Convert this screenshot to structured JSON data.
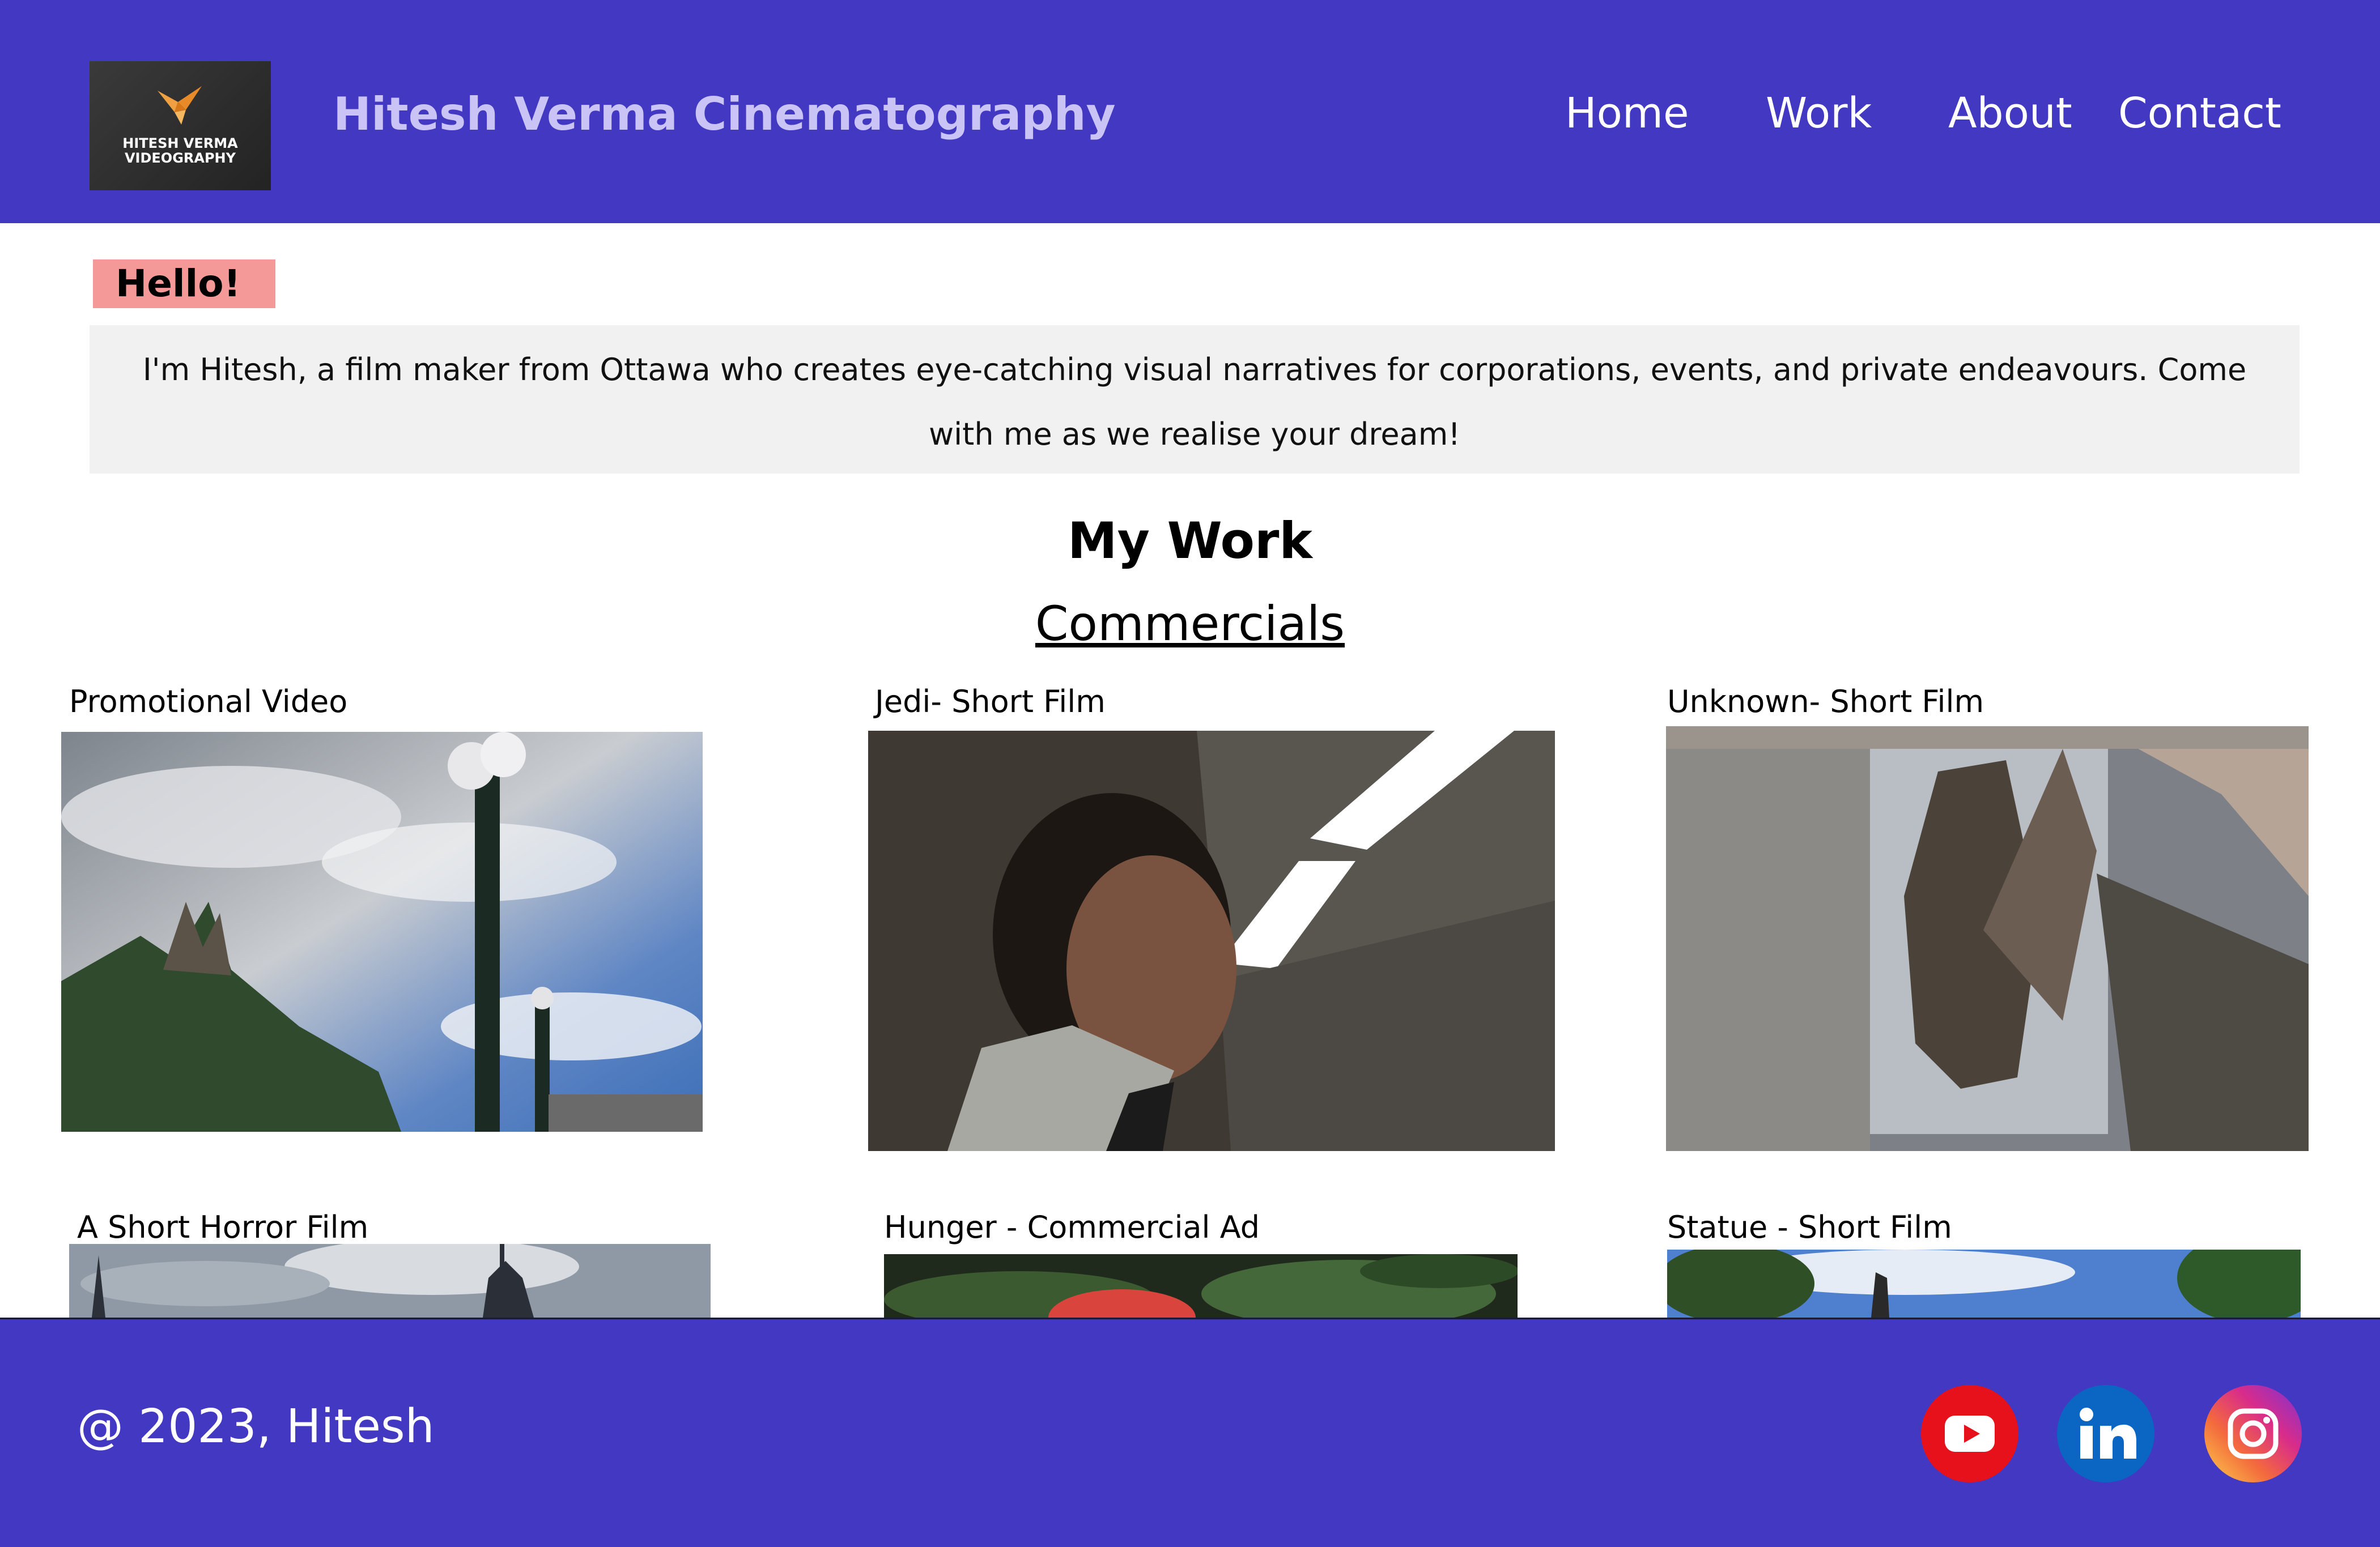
{
  "header": {
    "logo_text": "HITESH VERMA\nVIDEOGRAPHY",
    "logo_icon": "origami-bird-icon",
    "site_title": "Hitesh Verma Cinematography",
    "nav": [
      "Home",
      "Work",
      "About",
      "Contact"
    ],
    "background_color": "#4238c1"
  },
  "intro": {
    "greeting": "Hello!",
    "text": "I'm Hitesh, a film maker from Ottawa who creates eye-catching visual narratives for corporations, events, and private endeavours. Come with me as we realise your dream!",
    "greeting_color": "#f59898"
  },
  "work": {
    "heading": "My Work",
    "subheading": "Commercials",
    "cards": [
      {
        "title": "Promotional Video"
      },
      {
        "title": "Jedi- Short Film"
      },
      {
        "title": "Unknown- Short Film"
      },
      {
        "title": "A Short Horror Film"
      },
      {
        "title": "Hunger - Commercial Ad"
      },
      {
        "title": "Statue - Short Film"
      }
    ]
  },
  "footer": {
    "copyright": "@ 2023, Hitesh",
    "social": [
      "youtube-icon",
      "linkedin-icon",
      "instagram-icon"
    ],
    "background_color": "#4238c1"
  }
}
